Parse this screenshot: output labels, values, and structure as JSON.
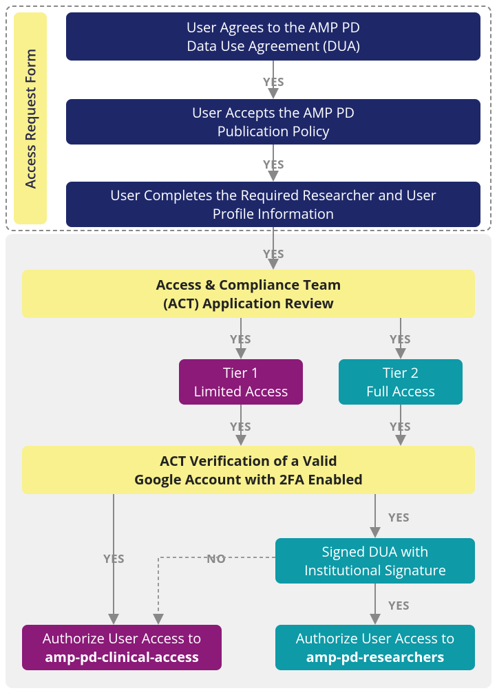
{
  "sidebar_label": "Access Request Form",
  "step1_l1": "User Agrees to the AMP PD",
  "step1_l2": "Data Use Agreement (DUA)",
  "step2_l1": "User Accepts the AMP PD",
  "step2_l2": "Publication Policy",
  "step3_l1": "User Completes the Required Researcher and User",
  "step3_l2": "Profile Information",
  "act_review_l1": "Access & Compliance Team",
  "act_review_l2": "(ACT) Application Review",
  "tier1_l1": "Tier 1",
  "tier1_l2": "Limited Access",
  "tier2_l1": "Tier 2",
  "tier2_l2": "Full Access",
  "act_verify_l1": "ACT Verification of a Valid",
  "act_verify_l2": "Google Account with 2FA Enabled",
  "signed_dua_l1": "Signed DUA with",
  "signed_dua_l2": "Institutional Signature",
  "auth1_l1": "Authorize User Access to",
  "auth1_l2": "amp-pd-clinical-access",
  "auth2_l1": "Authorize User Access to",
  "auth2_l2": "amp-pd-researchers",
  "yes": "YES",
  "no": "NO"
}
